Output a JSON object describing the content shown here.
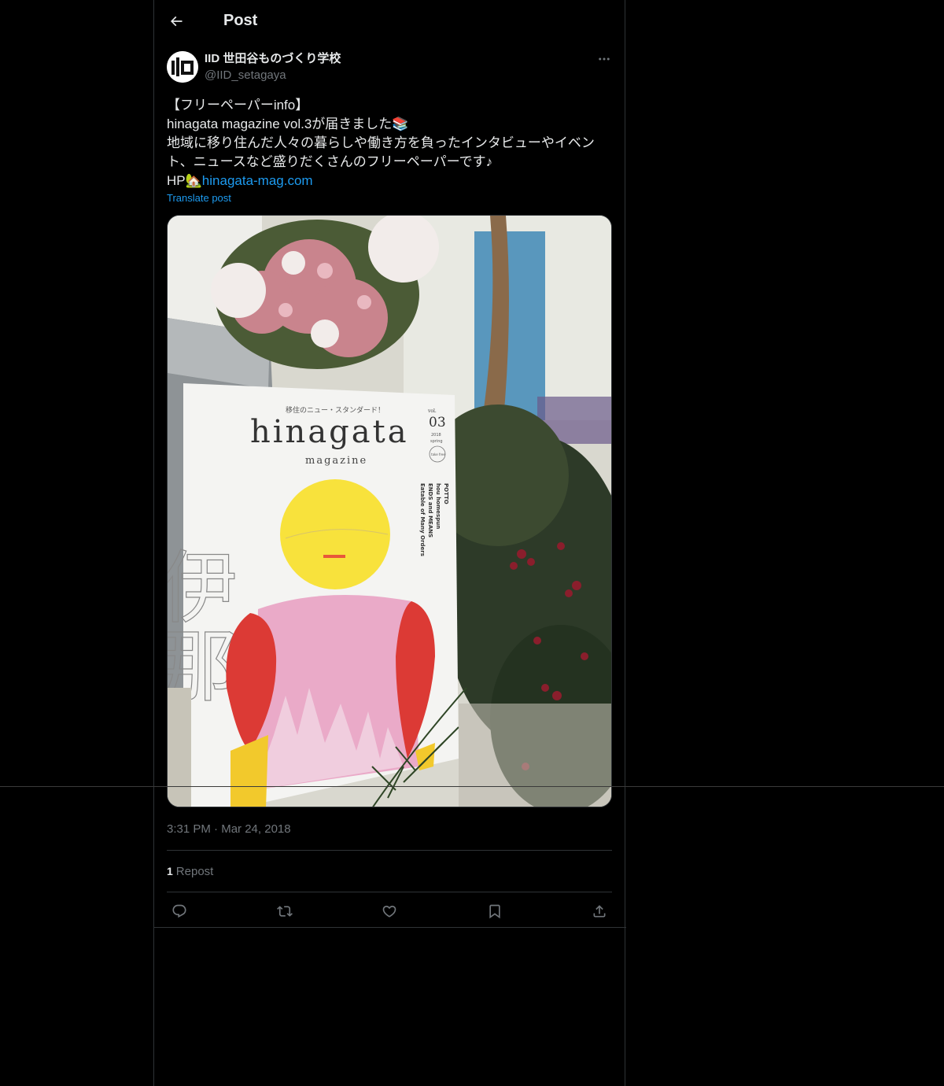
{
  "header": {
    "title": "Post"
  },
  "author": {
    "display_name": "IID 世田谷ものづくり学校",
    "handle": "@IID_setagaya"
  },
  "post": {
    "line1": "【フリーペーパーinfo】",
    "line2": "hinagata magazine vol.3が届きました📚",
    "line3": "地域に移り住んだ人々の暮らしや働き方を負ったインタビューやイベン",
    "line4": "ト、ニュースなど盛りだくさんのフリーペーパーです♪",
    "hp_prefix": "HP🏡",
    "link_text": "hinagata-mag.com",
    "translate_label": "Translate post"
  },
  "media": {
    "cover_catch": "移住のニュー・スタンダード！",
    "cover_title": "hinagata",
    "cover_subtitle": "magazine",
    "cover_vol": "03",
    "cover_vol_prefix": "vol.",
    "cover_year": "2018",
    "cover_edition": "spring",
    "cover_stamp": "take free",
    "cover_kanji": "伊那",
    "cover_contents": [
      "POTTO",
      "hou homespun",
      "ENDS and MEANS",
      "Eatable of Many Orders"
    ]
  },
  "meta": {
    "time": "3:31 PM",
    "separator": "·",
    "date": "Mar 24, 2018"
  },
  "stats": {
    "repost_count": "1",
    "repost_label": "Repost"
  },
  "icons": {
    "back": "arrow-left-icon",
    "more": "more-horizontal-icon",
    "reply": "reply-icon",
    "repost": "repost-icon",
    "like": "heart-icon",
    "bookmark": "bookmark-icon",
    "share": "share-icon"
  },
  "colors": {
    "accent": "#1d9bf0",
    "muted": "#71767b",
    "text": "#e7e9ea",
    "border": "#2f3336",
    "background": "#000000"
  }
}
